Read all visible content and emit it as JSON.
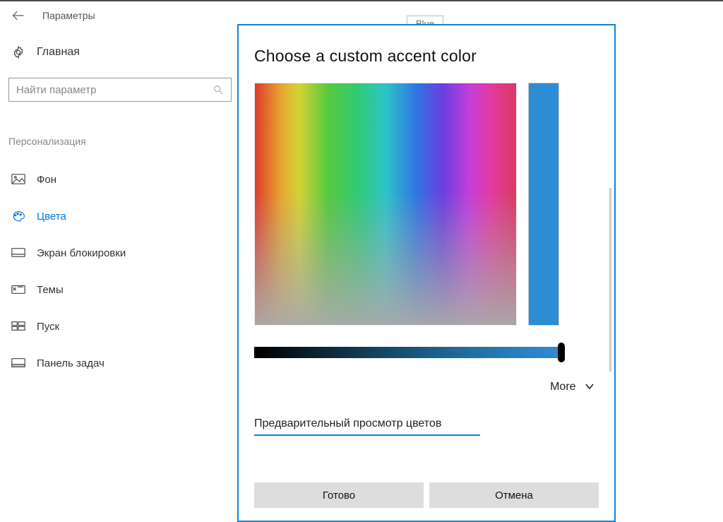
{
  "window": {
    "title": "Параметры"
  },
  "home": {
    "label": "Главная"
  },
  "search": {
    "placeholder": "Найти параметр"
  },
  "category": {
    "label": "Персонализация"
  },
  "nav": {
    "items": [
      {
        "label": "Фон"
      },
      {
        "label": "Цвета"
      },
      {
        "label": "Экран блокировки"
      },
      {
        "label": "Темы"
      },
      {
        "label": "Пуск"
      },
      {
        "label": "Панель задач"
      }
    ],
    "active_index": 1
  },
  "tooltip": {
    "text": "Blue"
  },
  "dialog": {
    "title": "Choose a custom accent color",
    "more_label": "More",
    "preview_label": "Предварительный просмотр цветов",
    "done_label": "Готово",
    "cancel_label": "Отмена",
    "selected_color": "#2d8cd6"
  }
}
